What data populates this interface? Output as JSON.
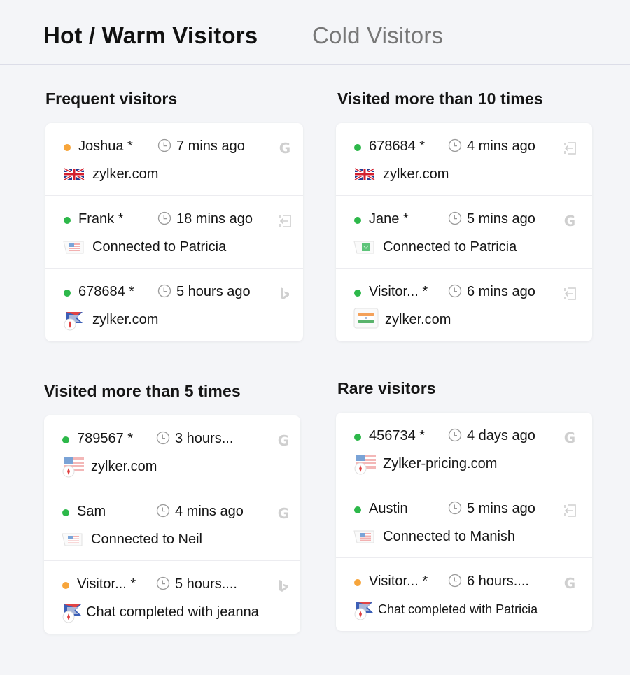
{
  "tabs": [
    {
      "label": "Hot / Warm Visitors",
      "active": true
    },
    {
      "label": "Cold Visitors",
      "active": false
    }
  ],
  "colors": {
    "online": "#2db84a",
    "idle": "#f7a53b",
    "muted_icon": "#c9c9c9"
  },
  "sections": [
    {
      "title": "Frequent visitors",
      "rows": [
        {
          "status": "idle",
          "name": "Joshua *",
          "time": "7 mins ago",
          "source_icon": "google-icon",
          "flag_icon": "uk-flag-icon",
          "detail": "zylker.com"
        },
        {
          "status": "online",
          "name": "Frank *",
          "time": "18 mins ago",
          "source_icon": "direct-entry-icon",
          "flag_icon": "us-flag-chat-icon",
          "detail": "Connected to Patricia"
        },
        {
          "status": "online",
          "name": "678684 *",
          "time": "5 hours ago",
          "source_icon": "bing-icon",
          "flag_icon": "flag-with-badge-icon",
          "detail": "zylker.com"
        }
      ]
    },
    {
      "title": "Visited more than 10 times",
      "rows": [
        {
          "status": "online",
          "name": "678684 *",
          "time": "4 mins ago",
          "source_icon": "direct-entry-icon",
          "flag_icon": "uk-flag-icon",
          "detail": "zylker.com"
        },
        {
          "status": "online",
          "name": "Jane *",
          "time": "5 mins ago",
          "source_icon": "google-icon",
          "flag_icon": "green-flag-chat-icon",
          "detail": "Connected to Patricia"
        },
        {
          "status": "online",
          "name": "Visitor... *",
          "time": "6 mins ago",
          "source_icon": "direct-entry-icon",
          "flag_icon": "india-flag-icon",
          "detail": "zylker.com"
        }
      ]
    },
    {
      "title": "Visited more than 5 times",
      "rows": [
        {
          "status": "online",
          "name": "789567 *",
          "time": "3 hours...",
          "source_icon": "google-icon",
          "flag_icon": "us-flag-badge-icon",
          "detail": "zylker.com"
        },
        {
          "status": "online",
          "name": "Sam",
          "time": "4 mins ago",
          "source_icon": "google-icon",
          "flag_icon": "us-flag-chat-icon",
          "detail": "Connected to Neil"
        },
        {
          "status": "idle",
          "name": "Visitor... *",
          "time": "5 hours....",
          "source_icon": "bing-icon",
          "flag_icon": "flag-with-badge-icon",
          "detail": "Chat completed with jeanna"
        }
      ]
    },
    {
      "title": "Rare visitors",
      "rows": [
        {
          "status": "online",
          "name": "456734 *",
          "time": "4 days ago",
          "source_icon": "google-icon",
          "flag_icon": "us-flag-badge-icon",
          "detail": "Zylker-pricing.com"
        },
        {
          "status": "online",
          "name": "Austin",
          "time": "5 mins ago",
          "source_icon": "direct-entry-icon",
          "flag_icon": "us-flag-chat-icon",
          "detail": "Connected to Manish"
        },
        {
          "status": "idle",
          "name": "Visitor... *",
          "time": "6 hours....",
          "source_icon": "google-icon",
          "flag_icon": "flag-with-badge-icon",
          "detail": "Chat completed with Patricia"
        }
      ]
    }
  ]
}
